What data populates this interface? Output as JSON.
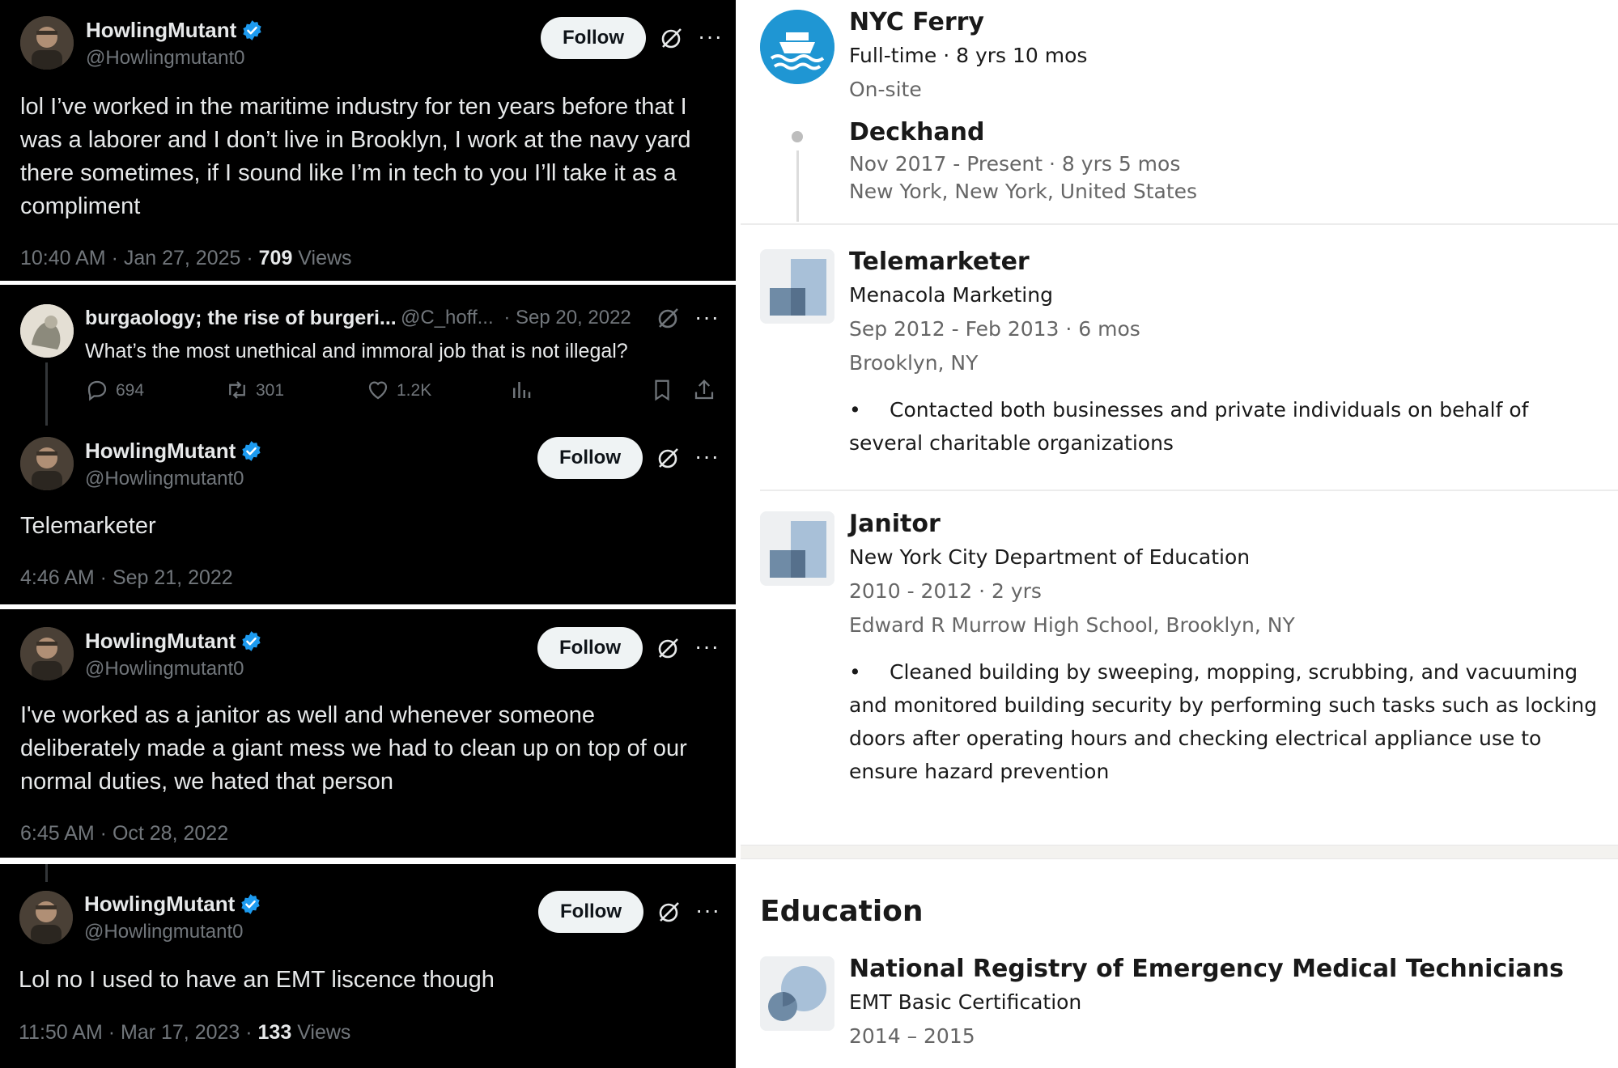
{
  "tweets": {
    "t1": {
      "name": "HowlingMutant",
      "handle": "@Howlingmutant0",
      "follow": "Follow",
      "text": "lol I’ve worked in the maritime industry for ten years before that I was a laborer and I don’t live in Brooklyn, I work at the navy yard there sometimes, if I sound like I’m in tech to you I’ll take it as a compliment",
      "time": "10:40 AM · Jan 27, 2025 · ",
      "views_count": "709",
      "views_label": " Views"
    },
    "q": {
      "name": "burgaology; the rise of burgeri...",
      "handle": "@C_hoff...",
      "date": "· Sep 20, 2022",
      "text": "What’s the most unethical and immoral job that is not illegal?",
      "replies": "694",
      "retweets": "301",
      "likes": "1.2K"
    },
    "t2": {
      "name": "HowlingMutant",
      "handle": "@Howlingmutant0",
      "follow": "Follow",
      "text": "Telemarketer",
      "time": "4:46 AM · Sep 21, 2022"
    },
    "t3": {
      "name": "HowlingMutant",
      "handle": "@Howlingmutant0",
      "follow": "Follow",
      "text": "I've worked as a janitor as well and whenever someone deliberately made a giant mess we had to clean up on top of our normal duties, we hated that person",
      "time": "6:45 AM · Oct 28, 2022"
    },
    "t4": {
      "name": "HowlingMutant",
      "handle": "@Howlingmutant0",
      "follow": "Follow",
      "text": "Lol no I used to have an EMT liscence though",
      "time": "11:50 AM · Mar 17, 2023 · ",
      "views_count": "133",
      "views_label": " Views"
    }
  },
  "profile": {
    "ferry": {
      "company": "NYC Ferry",
      "type": "Full-time · 8 yrs 10 mos",
      "mode": "On-site",
      "role": "Deckhand",
      "dates": "Nov 2017 - Present · 8 yrs 5 mos",
      "location": "New York, New York, United States"
    },
    "tele": {
      "title": "Telemarketer",
      "company": "Menacola Marketing",
      "dates": "Sep 2012 - Feb 2013 · 6 mos",
      "location": "Brooklyn, NY",
      "bullet": "•",
      "desc": "Contacted both businesses and private individuals on behalf of several charitable organizations"
    },
    "janitor": {
      "title": "Janitor",
      "company": "New York City Department of Education",
      "dates": "2010 - 2012 · 2 yrs",
      "location": "Edward R Murrow High School, Brooklyn, NY",
      "bullet": "•",
      "desc": "Cleaned building by sweeping, mopping, scrubbing, and vacuuming and monitored building security by performing such tasks such as locking doors after operating hours and checking electrical appliance use to ensure hazard prevention"
    },
    "education": {
      "heading": "Education",
      "school": "National Registry of Emergency Medical Technicians",
      "cert": "EMT Basic Certification",
      "years": "2014 – 2015"
    }
  },
  "colors": {
    "x_bg": "#000000",
    "x_text": "#e7e9ea",
    "x_muted": "#71767b",
    "verified": "#1d9bf0",
    "follow_bg": "#eff3f4",
    "li_muted": "#666666",
    "ferry_blue": "#1f96d3"
  }
}
